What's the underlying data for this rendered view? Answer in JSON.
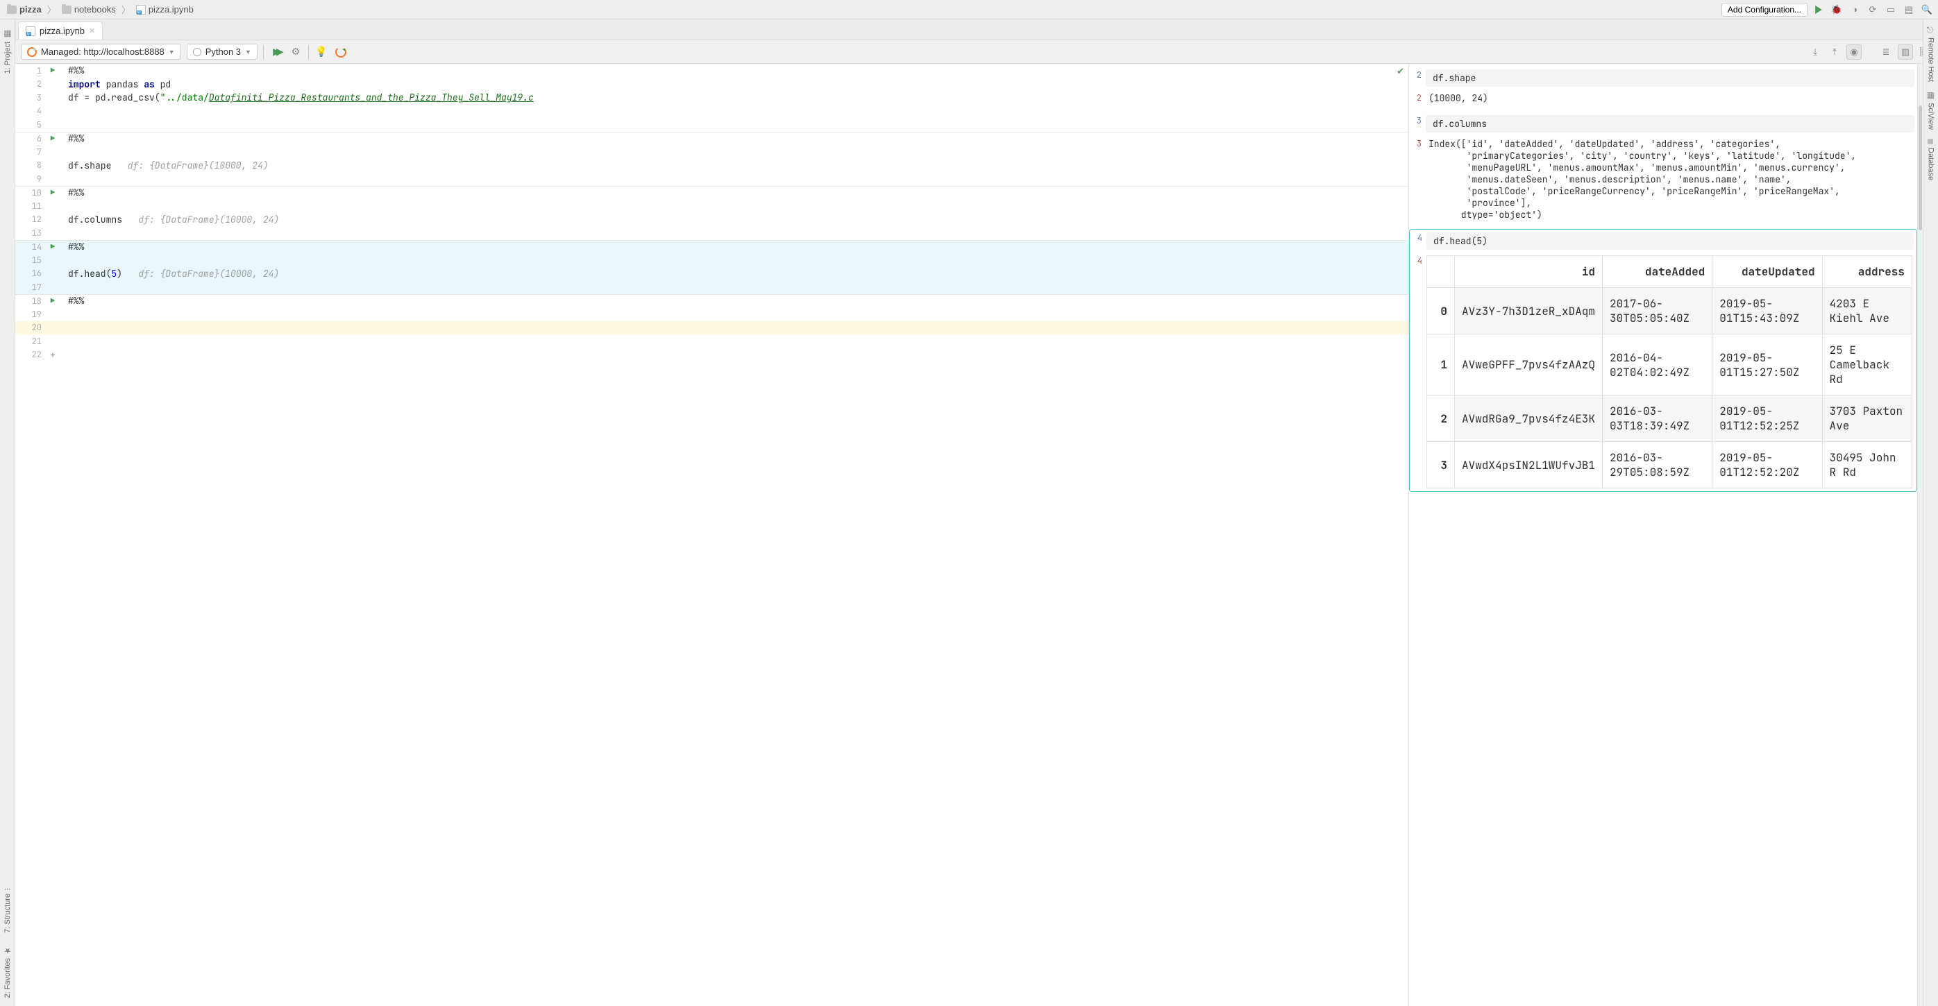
{
  "breadcrumbs": [
    "pizza",
    "notebooks",
    "pizza.ipynb"
  ],
  "top_buttons": {
    "add_config": "Add Configuration..."
  },
  "tab": {
    "name": "pizza.ipynb"
  },
  "nb_toolbar": {
    "server": "Managed: http://localhost:8888",
    "kernel": "Python 3"
  },
  "left_tools": {
    "project": "1: Project",
    "structure": "7: Structure",
    "favorites": "2: Favorites"
  },
  "right_tools": {
    "remote": "Remote Host",
    "sciview": "SciView",
    "database": "Database"
  },
  "code": {
    "line_count": 22,
    "cell_markers": [
      1,
      6,
      10,
      14,
      18
    ],
    "empty_sep_after": [
      5,
      9,
      13,
      17
    ],
    "current_line": 20,
    "active_cell_lines": [
      14,
      15,
      16,
      17
    ],
    "lines": {
      "1": "#%%",
      "2_kw1": "import",
      "2_mid": " pandas ",
      "2_kw2": "as",
      "2_end": " pd",
      "3_pre": "df = pd.read_csv(",
      "3_q": "\"",
      "3_path1": "../data/",
      "3_path2": "Datafiniti_Pizza_Restaurants_and_the_Pizza_They_Sell_May19.c",
      "6": "#%%",
      "8_code": "df.shape",
      "8_hint": "   df: {DataFrame}(10000, 24)",
      "10": "#%%",
      "12_code": "df.columns",
      "12_hint": "   df: {DataFrame}(10000, 24)",
      "14": "#%%",
      "16_code": "df.head(",
      "16_num": "5",
      "16_close": ")",
      "16_hint": "   df: {DataFrame}(10000, 24)",
      "18": "#%%"
    }
  },
  "outputs": {
    "o1": {
      "in_n": "2",
      "in": "df.shape",
      "out_n": "2",
      "out": "(10000, 24)"
    },
    "o2": {
      "in_n": "3",
      "in": "df.columns",
      "out_n": "3",
      "out": "Index(['id', 'dateAdded', 'dateUpdated', 'address', 'categories',\n       'primaryCategories', 'city', 'country', 'keys', 'latitude', 'longitude',\n       'menuPageURL', 'menus.amountMax', 'menus.amountMin', 'menus.currency',\n       'menus.dateSeen', 'menus.description', 'menus.name', 'name',\n       'postalCode', 'priceRangeCurrency', 'priceRangeMin', 'priceRangeMax',\n       'province'],\n      dtype='object')"
    },
    "o3": {
      "in_n": "4",
      "in": "df.head(5)",
      "out_n": "4",
      "cols": [
        "",
        "id",
        "dateAdded",
        "dateUpdated",
        "address"
      ],
      "rows": [
        [
          "0",
          "AVz3Y-7h3D1zeR_xDAqm",
          "2017-06-30T05:05:40Z",
          "2019-05-01T15:43:09Z",
          "4203 E Kiehl Ave"
        ],
        [
          "1",
          "AVweGPFF_7pvs4fzAAzQ",
          "2016-04-02T04:02:49Z",
          "2019-05-01T15:27:50Z",
          "25 E Camelback Rd"
        ],
        [
          "2",
          "AVwdRGa9_7pvs4fz4E3K",
          "2016-03-03T18:39:49Z",
          "2019-05-01T12:52:25Z",
          "3703 Paxton Ave"
        ],
        [
          "3",
          "AVwdX4psIN2L1WUfvJB1",
          "2016-03-29T05:08:59Z",
          "2019-05-01T12:52:20Z",
          "30495 John R Rd"
        ]
      ]
    }
  }
}
